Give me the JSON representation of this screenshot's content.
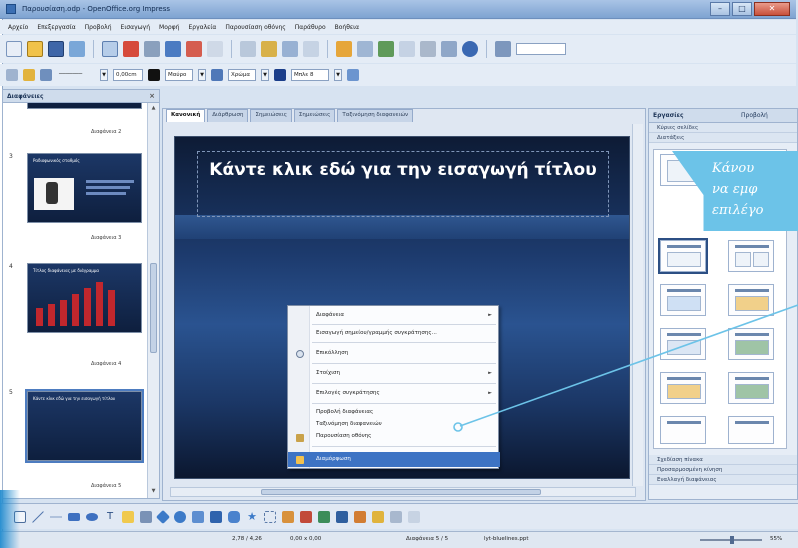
{
  "window": {
    "title": "Παρουσίαση.odp - OpenOffice.org Impress",
    "controls": {
      "min": "–",
      "max": "□",
      "close": "✕"
    }
  },
  "menu": [
    "Αρχείο",
    "Επεξεργασία",
    "Προβολή",
    "Εισαγωγή",
    "Μορφή",
    "Εργαλεία",
    "Παρουσίαση οθόνης",
    "Παράθυρο",
    "Βοήθεια"
  ],
  "toolbar2": {
    "line_width": "0,00cm",
    "color_label": "Μαύρο",
    "area_style": "Χρώμα",
    "area_color": "Μπλε 8"
  },
  "slides_pane": {
    "title": "Διαφάνειες",
    "items": [
      {
        "num": "",
        "caption": "Διαφάνεια 2",
        "title": ""
      },
      {
        "num": "3",
        "caption": "Διαφάνεια 3",
        "title": "Ραδιοφωνικός σταθμός"
      },
      {
        "num": "4",
        "caption": "Διαφάνεια 4",
        "title": "Τίτλος διαφάνειας με διάγραμμα"
      },
      {
        "num": "5",
        "caption": "Διαφάνεια 5",
        "title": "Κάντε κλικ εδώ για την εισαγωγή τίτλου"
      }
    ]
  },
  "tabs": [
    "Κανονική",
    "Διάρθρωση",
    "Σημειώσεις",
    "Σημειώσεις",
    "Ταξινόμηση διαφανειών"
  ],
  "slide": {
    "title": "Κάντε κλικ εδώ για την εισαγωγή τίτλου"
  },
  "context_menu": {
    "items": [
      {
        "label": "Διαφάνεια",
        "submenu": "►"
      },
      {
        "label": "Εισαγωγή σημείου/γραμμής συγκράτησης...",
        "submenu": ""
      },
      {
        "label": "Επικόλληση",
        "submenu": ""
      },
      {
        "label": "Στοίχιση",
        "submenu": "►"
      },
      {
        "label": "Επιλογές συγκράτησης",
        "submenu": "►"
      },
      {
        "label": "Προβολή διαφάνειας",
        "submenu": ""
      },
      {
        "label": "Ταξινόμηση διαφανειών",
        "submenu": ""
      },
      {
        "label": "Παρουσίαση οθόνης",
        "submenu": ""
      },
      {
        "label": "Διαμόρφωση",
        "submenu": ""
      }
    ]
  },
  "tasks_pane": {
    "title": "Εργασίες",
    "view": "Προβολή",
    "sections": {
      "master": "Κύριες σελίδες",
      "layouts": "Διατάξεις",
      "custom_animation": "Σχεδίαση πίνακα",
      "transition": "Προσαρμοσμένη κίνηση",
      "slide_transition": "Εναλλαγή διαφάνειας"
    }
  },
  "callout": {
    "lines": [
      "Κάνου",
      "να εμφ",
      "επιλέγο"
    ]
  },
  "status": {
    "position": "2,78 / 4,26",
    "size": "0,00 x 0,00",
    "slide": "Διαφάνεια 5 / 5",
    "master": "lyt-bluelines.ppt",
    "zoom": "55%"
  },
  "colors": {
    "accent": "#3d73c4",
    "callout": "#6cc3e8",
    "slide_bg": "#1d3b6e"
  }
}
